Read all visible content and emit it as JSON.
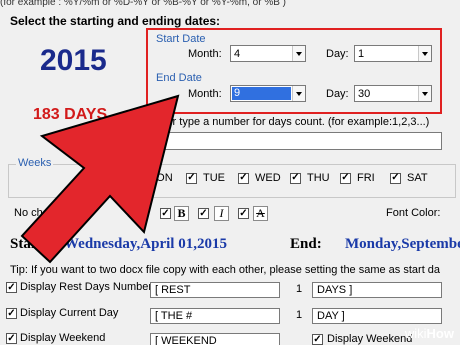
{
  "format_example": "(for example : %Y/%m or %D-%Y or %B-%Y or %Y-%m, or %B )",
  "section_title": "Select the starting and ending dates:",
  "year": "2015",
  "days_count": "183 DAYS",
  "start_date": {
    "group_label": "Start Date",
    "month_label": "Month:",
    "month_value": "4",
    "day_label": "Day:",
    "day_value": "1"
  },
  "end_date": {
    "group_label": "End Date",
    "month_label": "Month:",
    "month_value": "9",
    "day_label": "Day:",
    "day_value": "30"
  },
  "days_count_option": "Or type a number for days count. (for example:1,2,3...)",
  "weeks": {
    "label": "Weeks",
    "days": [
      {
        "label": "MON",
        "checked": true
      },
      {
        "label": "TUE",
        "checked": true
      },
      {
        "label": "WED",
        "checked": true
      },
      {
        "label": "THU",
        "checked": true
      },
      {
        "label": "FRI",
        "checked": true
      },
      {
        "label": "SAT",
        "checked": true
      }
    ]
  },
  "no_checked_label": "No checked W",
  "format_buttons": {
    "bold": "B",
    "italic": "I",
    "strike": "A"
  },
  "font_color_label": "Font Color:",
  "start_label": "Start:",
  "start_value": "Wednesday,April 01,2015",
  "end_label": "End:",
  "end_value": "Monday,September",
  "tip": "Tip: If you want to two docx file copy with each other, please setting the same as start da",
  "rows": [
    {
      "label": "Display Rest Days Number",
      "prefix": "[ REST",
      "count": "1",
      "suffix": "DAYS ]"
    },
    {
      "label": "Display Current Day",
      "prefix": "[ THE #",
      "count": "1",
      "suffix": "DAY ]"
    },
    {
      "label": "Display Weekend",
      "prefix": "[ WEEKEND",
      "count": "",
      "suffix": "Display Weekend"
    }
  ],
  "watermark": {
    "prefix": "wiki",
    "suffix": "How"
  },
  "colors": {
    "accent_red": "#e02020",
    "year_blue": "#1a2a8c",
    "days_red": "#d21a1a",
    "group_blue": "#2a5fb0",
    "arrow_red": "#e3262c"
  }
}
